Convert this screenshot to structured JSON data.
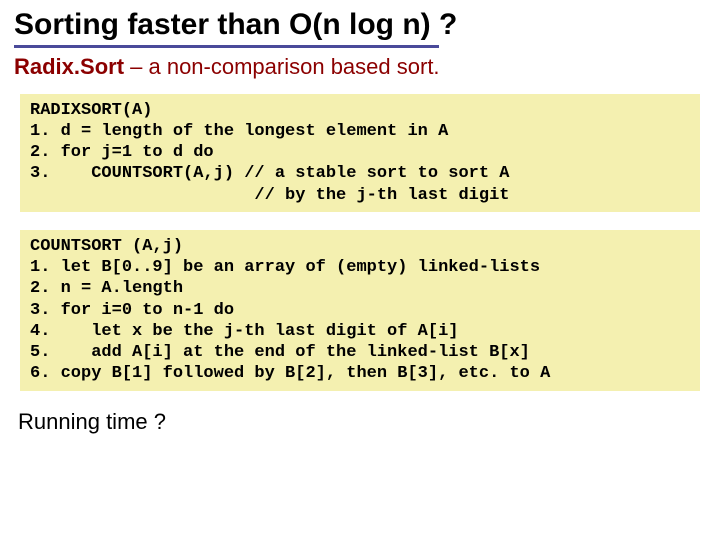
{
  "title": "Sorting faster than O(n log n) ?",
  "subtitle_bold": "Radix.Sort",
  "subtitle_rest": " – a non-comparison based sort.",
  "code1": "RADIXSORT(A)\n1. d = length of the longest element in A\n2. for j=1 to d do\n3.    COUNTSORT(A,j) // a stable sort to sort A\n                      // by the j-th last digit",
  "code2": "COUNTSORT (A,j)\n1. let B[0..9] be an array of (empty) linked-lists\n2. n = A.length\n3. for i=0 to n-1 do\n4.    let x be the j-th last digit of A[i]\n5.    add A[i] at the end of the linked-list B[x]\n6. copy B[1] followed by B[2], then B[3], etc. to A",
  "footer": "Running time ?"
}
